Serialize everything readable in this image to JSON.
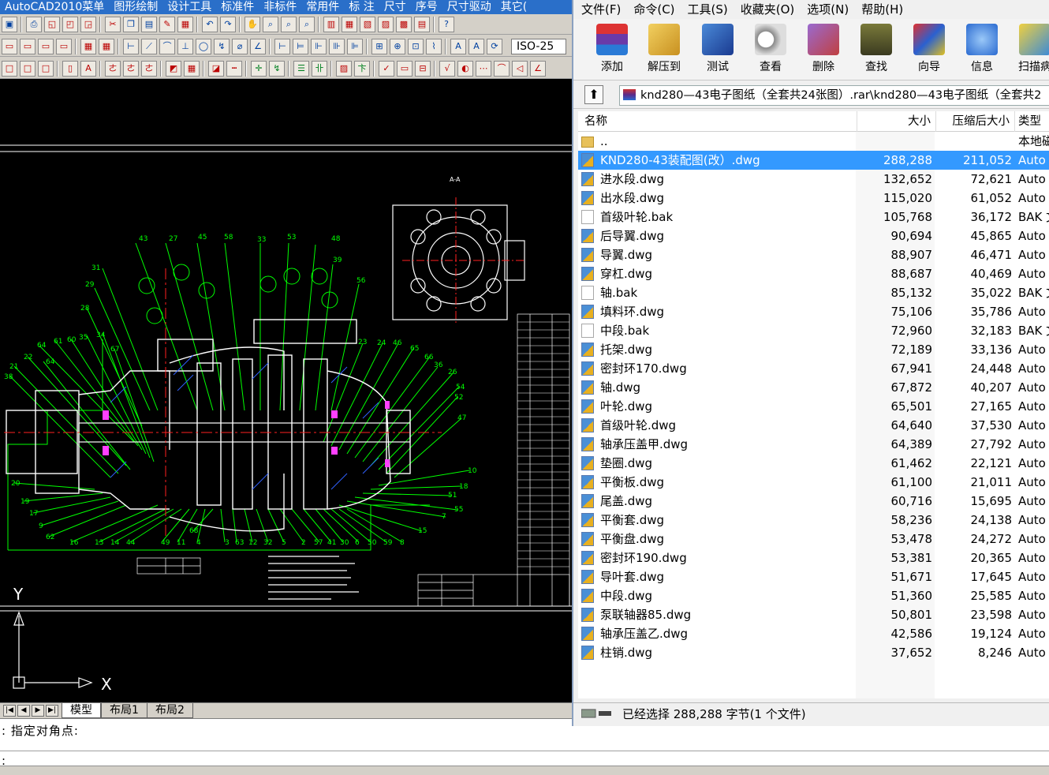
{
  "acad": {
    "menus": [
      "AutoCAD2010菜单",
      "图形绘制",
      "设计工具",
      "标准件",
      "非标件",
      "常用件",
      "标 注",
      "尺寸",
      "序号",
      "尺寸驱动",
      "其它("
    ],
    "dimstyle": "ISO-25",
    "layout_tabs": [
      "模型",
      "布局1",
      "布局2"
    ],
    "command_line": ": 指定对角点:",
    "command_prompt": ":",
    "ucs": {
      "y": "Y",
      "x": "X"
    },
    "drawing": {
      "section_label": "A-A",
      "balloons_top": [
        "43",
        "27",
        "45",
        "58",
        "33",
        "53",
        "48",
        "39",
        "56",
        "31",
        "29",
        "28"
      ],
      "balloons_left": [
        "64",
        "61",
        "60",
        "35",
        "34",
        "67",
        "22",
        "64",
        "21",
        "38",
        "20",
        "19",
        "17",
        "9",
        "62"
      ],
      "balloons_right": [
        "23",
        "24",
        "46",
        "65",
        "66",
        "36",
        "26",
        "54",
        "52",
        "47",
        "10",
        "18",
        "51",
        "55",
        "7",
        "15"
      ],
      "balloons_bottom": [
        "16",
        "13",
        "14",
        "44",
        "49",
        "11",
        "4",
        "3",
        "63",
        "12",
        "32",
        "5",
        "2",
        "57",
        "41",
        "30",
        "6",
        "50",
        "59",
        "8",
        "68"
      ]
    }
  },
  "rar": {
    "menus": [
      "文件(F)",
      "命令(C)",
      "工具(S)",
      "收藏夹(O)",
      "选项(N)",
      "帮助(H)"
    ],
    "toolbar": [
      "添加",
      "解压到",
      "测试",
      "查看",
      "删除",
      "查找",
      "向导",
      "信息",
      "扫描病"
    ],
    "path": "knd280—43电子图纸（全套共24张图）.rar\\knd280—43电子图纸（全套共2",
    "columns": {
      "name": "名称",
      "size": "大小",
      "packed": "压缩后大小",
      "type": "类型"
    },
    "parent": {
      "name": "..",
      "type": "本地磁"
    },
    "files": [
      {
        "name": "KND280-43装配图(改）.dwg",
        "size": "288,288",
        "packed": "211,052",
        "type": "Auto",
        "kind": "dwg",
        "selected": true
      },
      {
        "name": "进水段.dwg",
        "size": "132,652",
        "packed": "72,621",
        "type": "Auto",
        "kind": "dwg"
      },
      {
        "name": "出水段.dwg",
        "size": "115,020",
        "packed": "61,052",
        "type": "Auto",
        "kind": "dwg"
      },
      {
        "name": "首级叶轮.bak",
        "size": "105,768",
        "packed": "36,172",
        "type": "BAK 文",
        "kind": "bak"
      },
      {
        "name": "后导翼.dwg",
        "size": "90,694",
        "packed": "45,865",
        "type": "Auto",
        "kind": "dwg"
      },
      {
        "name": "导翼.dwg",
        "size": "88,907",
        "packed": "46,471",
        "type": "Auto",
        "kind": "dwg"
      },
      {
        "name": "穿杠.dwg",
        "size": "88,687",
        "packed": "40,469",
        "type": "Auto",
        "kind": "dwg"
      },
      {
        "name": "轴.bak",
        "size": "85,132",
        "packed": "35,022",
        "type": "BAK 文",
        "kind": "bak"
      },
      {
        "name": "填料环.dwg",
        "size": "75,106",
        "packed": "35,786",
        "type": "Auto",
        "kind": "dwg"
      },
      {
        "name": "中段.bak",
        "size": "72,960",
        "packed": "32,183",
        "type": "BAK 文",
        "kind": "bak"
      },
      {
        "name": "托架.dwg",
        "size": "72,189",
        "packed": "33,136",
        "type": "Auto",
        "kind": "dwg"
      },
      {
        "name": "密封环170.dwg",
        "size": "67,941",
        "packed": "24,448",
        "type": "Auto",
        "kind": "dwg"
      },
      {
        "name": "轴.dwg",
        "size": "67,872",
        "packed": "40,207",
        "type": "Auto",
        "kind": "dwg"
      },
      {
        "name": "叶轮.dwg",
        "size": "65,501",
        "packed": "27,165",
        "type": "Auto",
        "kind": "dwg"
      },
      {
        "name": "首级叶轮.dwg",
        "size": "64,640",
        "packed": "37,530",
        "type": "Auto",
        "kind": "dwg"
      },
      {
        "name": "轴承压盖甲.dwg",
        "size": "64,389",
        "packed": "27,792",
        "type": "Auto",
        "kind": "dwg"
      },
      {
        "name": "垫圈.dwg",
        "size": "61,462",
        "packed": "22,121",
        "type": "Auto",
        "kind": "dwg"
      },
      {
        "name": "平衡板.dwg",
        "size": "61,100",
        "packed": "21,011",
        "type": "Auto",
        "kind": "dwg"
      },
      {
        "name": "尾盖.dwg",
        "size": "60,716",
        "packed": "15,695",
        "type": "Auto",
        "kind": "dwg"
      },
      {
        "name": "平衡套.dwg",
        "size": "58,236",
        "packed": "24,138",
        "type": "Auto",
        "kind": "dwg"
      },
      {
        "name": "平衡盘.dwg",
        "size": "53,478",
        "packed": "24,272",
        "type": "Auto",
        "kind": "dwg"
      },
      {
        "name": "密封环190.dwg",
        "size": "53,381",
        "packed": "20,365",
        "type": "Auto",
        "kind": "dwg"
      },
      {
        "name": "导叶套.dwg",
        "size": "51,671",
        "packed": "17,645",
        "type": "Auto",
        "kind": "dwg"
      },
      {
        "name": "中段.dwg",
        "size": "51,360",
        "packed": "25,585",
        "type": "Auto",
        "kind": "dwg"
      },
      {
        "name": "泵联轴器85.dwg",
        "size": "50,801",
        "packed": "23,598",
        "type": "Auto",
        "kind": "dwg"
      },
      {
        "name": "轴承压盖乙.dwg",
        "size": "42,586",
        "packed": "19,124",
        "type": "Auto",
        "kind": "dwg"
      },
      {
        "name": "柱销.dwg",
        "size": "37,652",
        "packed": "8,246",
        "type": "Auto",
        "kind": "dwg"
      }
    ],
    "status": "已经选择 288,288 字节(1 个文件)"
  }
}
